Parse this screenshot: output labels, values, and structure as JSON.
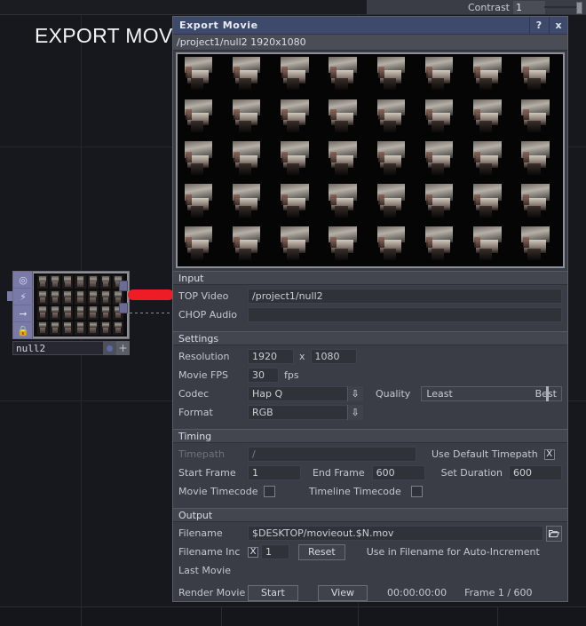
{
  "desktop": {
    "export_title": "EXPORT MOVIE",
    "contrast_label": "Contrast",
    "contrast_value": "1"
  },
  "node": {
    "name": "null2",
    "flags": [
      "viewer-icon",
      "render-icon",
      "display-icon",
      "clone-icon"
    ]
  },
  "dialog": {
    "title": "Export Movie",
    "help_label": "?",
    "close_label": "x",
    "path_line": "/project1/null2 1920x1080",
    "sections": {
      "input": {
        "header": "Input",
        "top_video_label": "TOP Video",
        "top_video_value": "/project1/null2",
        "chop_audio_label": "CHOP Audio",
        "chop_audio_value": ""
      },
      "settings": {
        "header": "Settings",
        "resolution_label": "Resolution",
        "resolution_w": "1920",
        "resolution_x": "x",
        "resolution_h": "1080",
        "fps_label": "Movie FPS",
        "fps_value": "30",
        "fps_unit": "fps",
        "codec_label": "Codec",
        "codec_value": "Hap Q",
        "quality_label": "Quality",
        "quality_min": "Least",
        "quality_max": "Best",
        "format_label": "Format",
        "format_value": "RGB"
      },
      "timing": {
        "header": "Timing",
        "timepath_label": "Timepath",
        "timepath_value": "/",
        "use_default_label": "Use Default Timepath",
        "use_default_checked": "X",
        "start_frame_label": "Start Frame",
        "start_frame_value": "1",
        "end_frame_label": "End Frame",
        "end_frame_value": "600",
        "set_duration_label": "Set Duration",
        "set_duration_value": "600",
        "movie_timecode_label": "Movie Timecode",
        "timeline_timecode_label": "Timeline Timecode"
      },
      "output": {
        "header": "Output",
        "filename_label": "Filename",
        "filename_value": "$DESKTOP/movieout.$N.mov",
        "filename_inc_label": "Filename Inc",
        "filename_inc_checked": "X",
        "filename_inc_value": "1",
        "reset_label": "Reset",
        "hint": "Use  in Filename for Auto-Increment",
        "last_movie_label": "Last Movie",
        "last_movie_value": "",
        "render_movie_label": "Render Movie",
        "start_label": "Start",
        "view_label": "View",
        "timecode": "00:00:00:00",
        "frame_status": "Frame 1 / 600"
      }
    }
  },
  "colors": {
    "titlebar": "#3e4a6b",
    "dialog_bg": "#3a3d45",
    "accent_wire": "#ee1c25",
    "node_flag": "#7a7aa8"
  }
}
